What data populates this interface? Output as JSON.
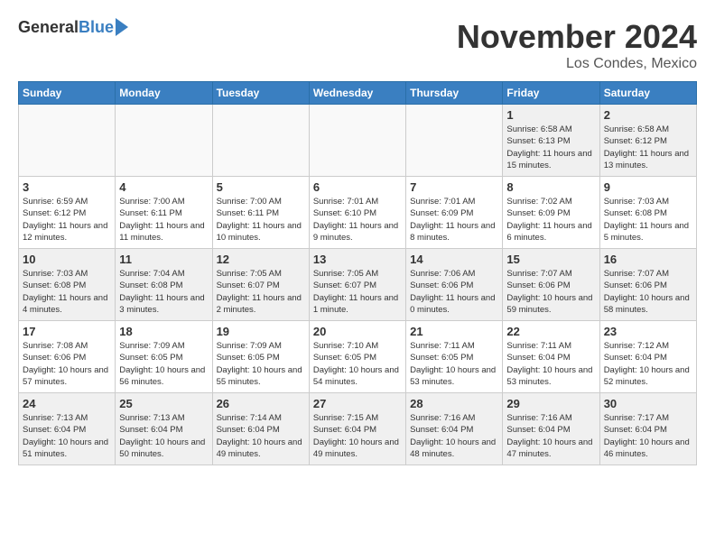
{
  "header": {
    "logo_general": "General",
    "logo_blue": "Blue",
    "month_title": "November 2024",
    "location": "Los Condes, Mexico"
  },
  "days_of_week": [
    "Sunday",
    "Monday",
    "Tuesday",
    "Wednesday",
    "Thursday",
    "Friday",
    "Saturday"
  ],
  "weeks": [
    [
      {
        "day": "",
        "info": ""
      },
      {
        "day": "",
        "info": ""
      },
      {
        "day": "",
        "info": ""
      },
      {
        "day": "",
        "info": ""
      },
      {
        "day": "",
        "info": ""
      },
      {
        "day": "1",
        "info": "Sunrise: 6:58 AM\nSunset: 6:13 PM\nDaylight: 11 hours and 15 minutes."
      },
      {
        "day": "2",
        "info": "Sunrise: 6:58 AM\nSunset: 6:12 PM\nDaylight: 11 hours and 13 minutes."
      }
    ],
    [
      {
        "day": "3",
        "info": "Sunrise: 6:59 AM\nSunset: 6:12 PM\nDaylight: 11 hours and 12 minutes."
      },
      {
        "day": "4",
        "info": "Sunrise: 7:00 AM\nSunset: 6:11 PM\nDaylight: 11 hours and 11 minutes."
      },
      {
        "day": "5",
        "info": "Sunrise: 7:00 AM\nSunset: 6:11 PM\nDaylight: 11 hours and 10 minutes."
      },
      {
        "day": "6",
        "info": "Sunrise: 7:01 AM\nSunset: 6:10 PM\nDaylight: 11 hours and 9 minutes."
      },
      {
        "day": "7",
        "info": "Sunrise: 7:01 AM\nSunset: 6:09 PM\nDaylight: 11 hours and 8 minutes."
      },
      {
        "day": "8",
        "info": "Sunrise: 7:02 AM\nSunset: 6:09 PM\nDaylight: 11 hours and 6 minutes."
      },
      {
        "day": "9",
        "info": "Sunrise: 7:03 AM\nSunset: 6:08 PM\nDaylight: 11 hours and 5 minutes."
      }
    ],
    [
      {
        "day": "10",
        "info": "Sunrise: 7:03 AM\nSunset: 6:08 PM\nDaylight: 11 hours and 4 minutes."
      },
      {
        "day": "11",
        "info": "Sunrise: 7:04 AM\nSunset: 6:08 PM\nDaylight: 11 hours and 3 minutes."
      },
      {
        "day": "12",
        "info": "Sunrise: 7:05 AM\nSunset: 6:07 PM\nDaylight: 11 hours and 2 minutes."
      },
      {
        "day": "13",
        "info": "Sunrise: 7:05 AM\nSunset: 6:07 PM\nDaylight: 11 hours and 1 minute."
      },
      {
        "day": "14",
        "info": "Sunrise: 7:06 AM\nSunset: 6:06 PM\nDaylight: 11 hours and 0 minutes."
      },
      {
        "day": "15",
        "info": "Sunrise: 7:07 AM\nSunset: 6:06 PM\nDaylight: 10 hours and 59 minutes."
      },
      {
        "day": "16",
        "info": "Sunrise: 7:07 AM\nSunset: 6:06 PM\nDaylight: 10 hours and 58 minutes."
      }
    ],
    [
      {
        "day": "17",
        "info": "Sunrise: 7:08 AM\nSunset: 6:06 PM\nDaylight: 10 hours and 57 minutes."
      },
      {
        "day": "18",
        "info": "Sunrise: 7:09 AM\nSunset: 6:05 PM\nDaylight: 10 hours and 56 minutes."
      },
      {
        "day": "19",
        "info": "Sunrise: 7:09 AM\nSunset: 6:05 PM\nDaylight: 10 hours and 55 minutes."
      },
      {
        "day": "20",
        "info": "Sunrise: 7:10 AM\nSunset: 6:05 PM\nDaylight: 10 hours and 54 minutes."
      },
      {
        "day": "21",
        "info": "Sunrise: 7:11 AM\nSunset: 6:05 PM\nDaylight: 10 hours and 53 minutes."
      },
      {
        "day": "22",
        "info": "Sunrise: 7:11 AM\nSunset: 6:04 PM\nDaylight: 10 hours and 53 minutes."
      },
      {
        "day": "23",
        "info": "Sunrise: 7:12 AM\nSunset: 6:04 PM\nDaylight: 10 hours and 52 minutes."
      }
    ],
    [
      {
        "day": "24",
        "info": "Sunrise: 7:13 AM\nSunset: 6:04 PM\nDaylight: 10 hours and 51 minutes."
      },
      {
        "day": "25",
        "info": "Sunrise: 7:13 AM\nSunset: 6:04 PM\nDaylight: 10 hours and 50 minutes."
      },
      {
        "day": "26",
        "info": "Sunrise: 7:14 AM\nSunset: 6:04 PM\nDaylight: 10 hours and 49 minutes."
      },
      {
        "day": "27",
        "info": "Sunrise: 7:15 AM\nSunset: 6:04 PM\nDaylight: 10 hours and 49 minutes."
      },
      {
        "day": "28",
        "info": "Sunrise: 7:16 AM\nSunset: 6:04 PM\nDaylight: 10 hours and 48 minutes."
      },
      {
        "day": "29",
        "info": "Sunrise: 7:16 AM\nSunset: 6:04 PM\nDaylight: 10 hours and 47 minutes."
      },
      {
        "day": "30",
        "info": "Sunrise: 7:17 AM\nSunset: 6:04 PM\nDaylight: 10 hours and 46 minutes."
      }
    ]
  ]
}
